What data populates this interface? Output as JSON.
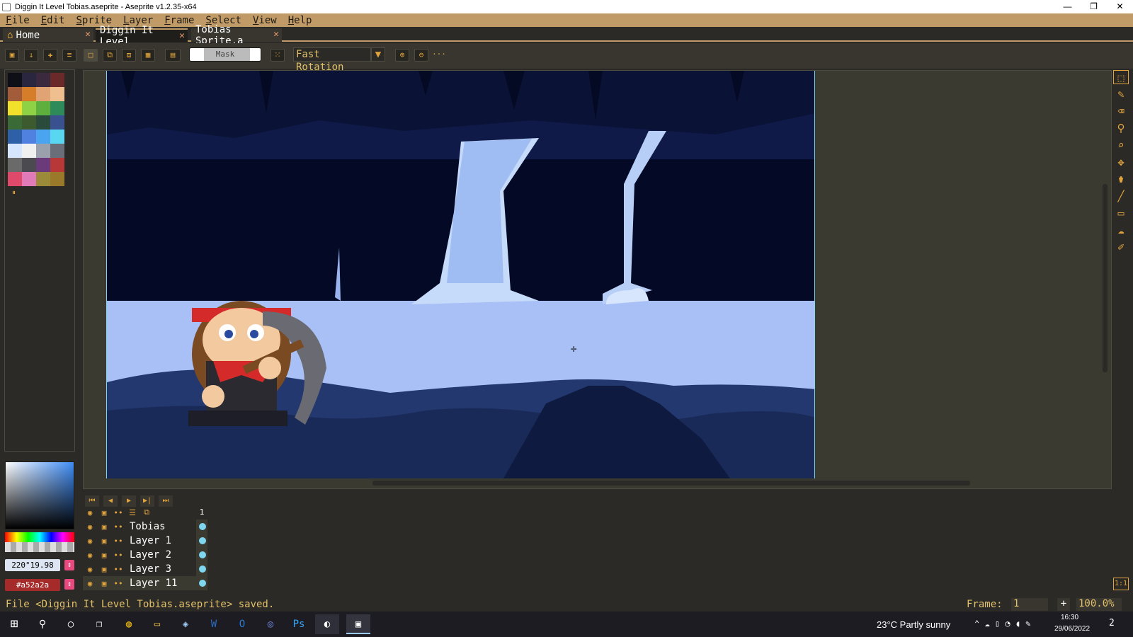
{
  "window": {
    "title": "Diggin It Level Tobias.aseprite - Aseprite v1.2.35-x64",
    "min": "—",
    "max": "❐",
    "close": "✕"
  },
  "menu": [
    "File",
    "Edit",
    "Sprite",
    "Layer",
    "Frame",
    "Select",
    "View",
    "Help"
  ],
  "tabs": [
    {
      "label": "Home",
      "icon": "home-icon",
      "active": false
    },
    {
      "label": "Diggin It Level",
      "active": true
    },
    {
      "label": "Tobias Sprite.a",
      "active": false
    }
  ],
  "toolbar": {
    "mask_label": "Mask",
    "rotation": "Fast Rotation",
    "more": "···"
  },
  "palette": [
    "#0f0f17",
    "#2a2640",
    "#3b2a3e",
    "#6b2a2a",
    "#a25c3a",
    "#d67d2a",
    "#e0a374",
    "#efbf8f",
    "#f2e12a",
    "#8fd245",
    "#5db03d",
    "#2e8a5a",
    "#3a6a36",
    "#3d5a2e",
    "#2a4a3c",
    "#3a5190",
    "#2e60a8",
    "#5080e0",
    "#4aa4f0",
    "#59d6f0",
    "#d6e6ff",
    "#f0f0f0",
    "#9aa0ac",
    "#6a6e78",
    "#6a6a6a",
    "#4a4a50",
    "#6b3a7a",
    "#b83838",
    "#e04a6a",
    "#e07ab8",
    "#9a8a3a",
    "#9a7a2a"
  ],
  "colors": {
    "fg_hex": "220°19.98",
    "bg_hex": "#a52a2a",
    "fg_swatch": "#dde5f2",
    "bg_swatch": "#a52a2a",
    "accent": "#c19b67",
    "timeline_dot": "#7fd6ef"
  },
  "timeline": {
    "frame_header": "1",
    "layers": [
      {
        "name": "Tobias"
      },
      {
        "name": "Layer 1"
      },
      {
        "name": "Layer 2"
      },
      {
        "name": "Layer 3"
      },
      {
        "name": "Layer 11"
      }
    ]
  },
  "status": {
    "message": "File <Diggin It Level Tobias.aseprite> saved.",
    "frame_label": "Frame:",
    "frame_value": "1",
    "zoom": "100.0%",
    "plus": "+"
  },
  "taskbar": {
    "weather": "23°C  Partly sunny",
    "time": "16:30",
    "date": "29/06/2022",
    "notif": "2"
  }
}
